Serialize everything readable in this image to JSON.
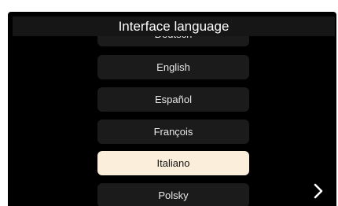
{
  "header": {
    "title": "Interface language"
  },
  "languages": [
    {
      "label": "Deutsch",
      "selected": false
    },
    {
      "label": "English",
      "selected": false
    },
    {
      "label": "Español",
      "selected": false
    },
    {
      "label": "François",
      "selected": false
    },
    {
      "label": "Italiano",
      "selected": true
    },
    {
      "label": "Polsky",
      "selected": false
    }
  ],
  "navigation": {
    "next_icon": "chevron-right-icon"
  },
  "colors": {
    "background": "#000000",
    "item_background": "#1b1b1b",
    "selected_item_background": "#fbeedb",
    "text": "#ffffff"
  }
}
